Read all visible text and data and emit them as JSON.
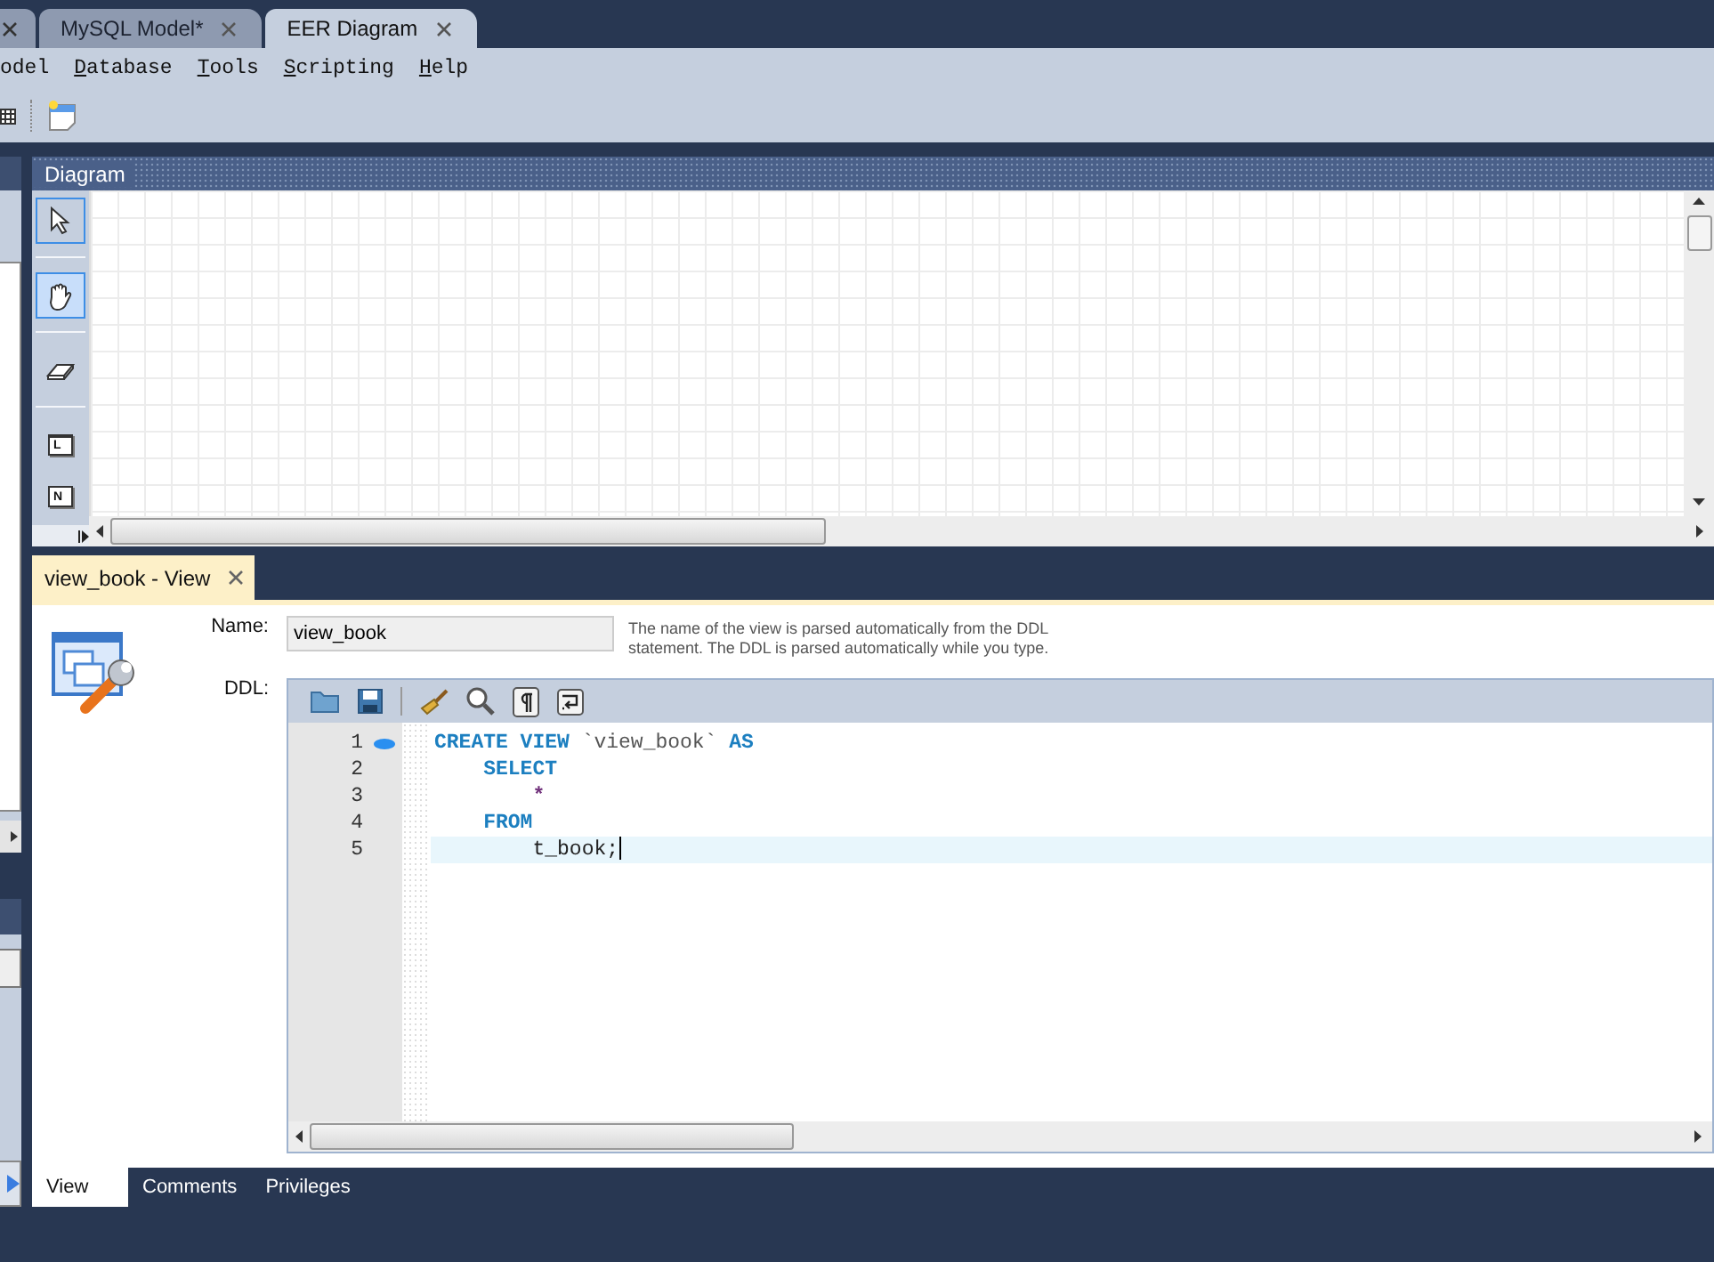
{
  "document_tabs": [
    {
      "label": "MySQL Model*",
      "selected": false
    },
    {
      "label": "EER Diagram",
      "selected": true
    }
  ],
  "menu": [
    {
      "label": "odel",
      "underline_first": false
    },
    {
      "label": "Database",
      "underline_first": true
    },
    {
      "label": "Tools",
      "underline_first": true
    },
    {
      "label": "Scripting",
      "underline_first": true
    },
    {
      "label": "Help",
      "underline_first": true
    }
  ],
  "diagram": {
    "title": "Diagram",
    "tools": [
      {
        "kind": "pointer",
        "selected": true
      },
      {
        "kind": "hand",
        "selected": true
      },
      {
        "kind": "eraser",
        "selected": false
      },
      {
        "kind": "layer",
        "glyph": "L",
        "selected": false
      },
      {
        "kind": "note",
        "glyph": "N",
        "selected": false
      }
    ]
  },
  "editor": {
    "tab": "view_book - View",
    "name_label": "Name:",
    "name_value": "view_book",
    "hint": "The name of the view is parsed automatically from the DDL statement. The DDL is parsed automatically while you type.",
    "ddl_label": "DDL:",
    "code_lines": [
      {
        "number": "1",
        "marker": true,
        "current": false,
        "tokens": [
          {
            "kind": "keyword",
            "text": "CREATE VIEW"
          },
          {
            "kind": "identifier",
            "text": " `view_book`"
          },
          {
            "kind": "keyword",
            "text": " AS"
          }
        ]
      },
      {
        "number": "2",
        "marker": false,
        "current": false,
        "tokens": [
          {
            "kind": "keyword",
            "text": "    SELECT"
          }
        ]
      },
      {
        "number": "3",
        "marker": false,
        "current": false,
        "tokens": [
          {
            "kind": "operator",
            "text": "        *"
          }
        ]
      },
      {
        "number": "4",
        "marker": false,
        "current": false,
        "tokens": [
          {
            "kind": "keyword",
            "text": "    FROM"
          }
        ]
      },
      {
        "number": "5",
        "marker": false,
        "current": true,
        "tokens": [
          {
            "kind": "plain",
            "text": "        t_book;"
          }
        ]
      }
    ],
    "bottom_tabs": [
      {
        "label": "View",
        "selected": true
      },
      {
        "label": "Comments",
        "selected": false
      },
      {
        "label": "Privileges",
        "selected": false
      }
    ]
  }
}
